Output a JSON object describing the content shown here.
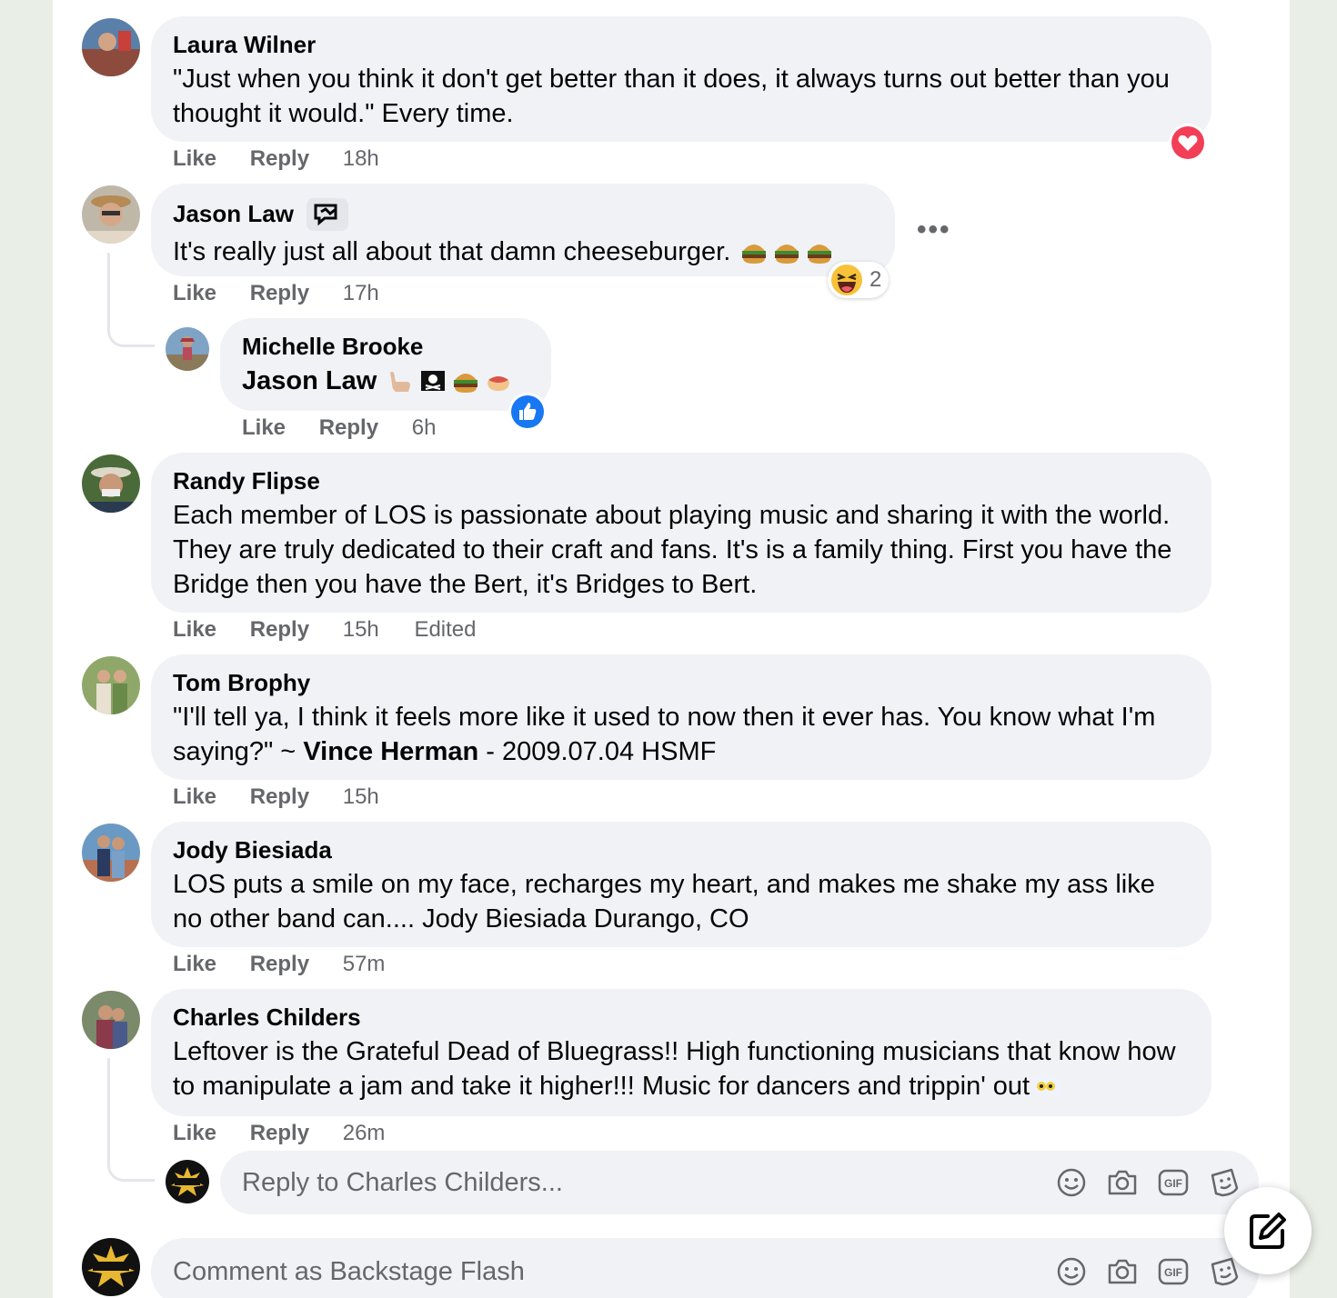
{
  "comments": [
    {
      "author": "Laura Wilner",
      "text": "\"Just when you think it don't get better than it does, it always turns out better than you thought it would.\" Every time.",
      "like": "Like",
      "reply": "Reply",
      "time": "18h"
    },
    {
      "author": "Jason Law",
      "text": "It's really just all about that damn cheeseburger.",
      "like": "Like",
      "reply": "Reply",
      "time": "17h",
      "reaction_count": "2"
    },
    {
      "author": "Michelle Brooke",
      "text": "Jason Law",
      "like": "Like",
      "reply": "Reply",
      "time": "6h"
    },
    {
      "author": "Randy Flipse",
      "text": "Each member of LOS is passionate about playing music and sharing it with the world. They are truly dedicated to their craft and fans. It's is a family thing. First you have the Bridge then you have the Bert, it's Bridges to Bert.",
      "like": "Like",
      "reply": "Reply",
      "time": "15h",
      "edited": "Edited"
    },
    {
      "author": "Tom Brophy",
      "text_before": "\"I'll tell ya, I think it feels more like it used to now then it ever has. You know what I'm saying?\" ~ ",
      "text_bold": "Vince Herman",
      "text_after": " - 2009.07.04 HSMF",
      "like": "Like",
      "reply": "Reply",
      "time": "15h"
    },
    {
      "author": "Jody Biesiada",
      "text": "LOS puts a smile on my face, recharges my heart, and makes me shake my ass like no other band can.... Jody Biesiada Durango, CO",
      "like": "Like",
      "reply": "Reply",
      "time": "57m"
    },
    {
      "author": "Charles Childers",
      "text": "Leftover is the Grateful Dead of Bluegrass!! High functioning musicians that know how to manipulate a jam and take it higher!!! Music for dancers and trippin' out",
      "like": "Like",
      "reply": "Reply",
      "time": "26m"
    }
  ],
  "reply_input": {
    "placeholder": "Reply to Charles Childers..."
  },
  "comment_input": {
    "placeholder": "Comment as Backstage Flash"
  },
  "colors": {
    "heart": "#f33e58",
    "like_blue": "#1877f2",
    "bubble": "#f0f2f5",
    "muted": "#65676b"
  },
  "icons": [
    "heart-reaction-icon",
    "haha-reaction-icon",
    "like-reaction-icon",
    "more-options-icon",
    "emoji-icon",
    "camera-icon",
    "gif-icon",
    "sticker-icon",
    "compose-icon",
    "top-fan-badge-icon"
  ]
}
